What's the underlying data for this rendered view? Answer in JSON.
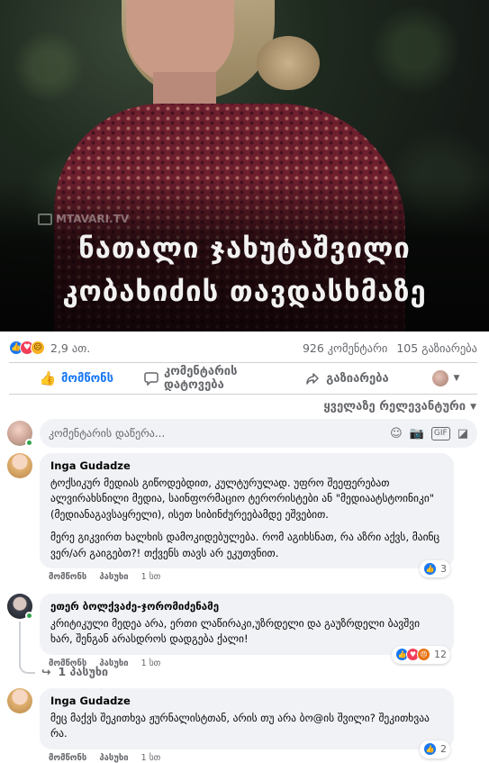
{
  "post": {
    "watermark": "MTAVARI.TV",
    "headline_line1": "ნათალი ჯახუტაშვილი",
    "headline_line2": "კობახიძის თავდასხმაზე"
  },
  "stats": {
    "reactions": [
      "like-reaction",
      "love-reaction",
      "sad-reaction"
    ],
    "reaction_count": "2,9 ათ.",
    "comments": "926 კომენტარი",
    "shares": "105 გაზიარება"
  },
  "actions": {
    "like": "მომწონს",
    "comment": "კომენტარის დატოვება",
    "share": "გაზიარება"
  },
  "sort_label": "ყველაზე რელევანტური",
  "composer": {
    "placeholder": "კომენტარის დაწერა..."
  },
  "comments": [
    {
      "author": "Inga Gudadze",
      "paragraph1": "ტოქსიკურ მედიას გიწოდებდით, კულტურულად. უფრო შეეფერებათ ალვირახსნილი მედია, საინფორმაციო ტერორისტები ან \"მედიაატსტოინიკი\" (მედიანაგავსაყრელი), ისეთ სიბინძურეებამდე ეშვებით.",
      "paragraph2": "მერე გიკვირთ ხალხის დამოკიდებულება. რომ აგიხსნათ, რა აზრი აქვს, მაინც ვერ/არ გაიგებთ?! თქვენს თავს არ ეკუთვნით.",
      "like": "მომწონს",
      "reply": "პასუხი",
      "time": "1 სთ",
      "reaction_count": "3"
    },
    {
      "author": "ეთერ ბოლქვაძე-ჯორომიძენამე",
      "text": "კრიტიკული მედეა არა, ერთი ლაწირაკი,უზრდელი და გაუზრდელი ბავშვი ხარ, შენგან არასდროს დადგება ქალი!",
      "like": "მომწონს",
      "reply": "პასუხი",
      "time": "1 სთ",
      "reaction_count": "12",
      "replies_label": "1 პასუხი"
    },
    {
      "author": "Inga Gudadze",
      "text": "მეც მაქვს შეკითხვა ჟურნალისტთან, არის თუ არა ბო@ის შვილი? შეკითხვაა რა.",
      "like": "მომწონს",
      "reply": "პასუხი",
      "time": "1 სთ",
      "reaction_count": "2"
    }
  ]
}
